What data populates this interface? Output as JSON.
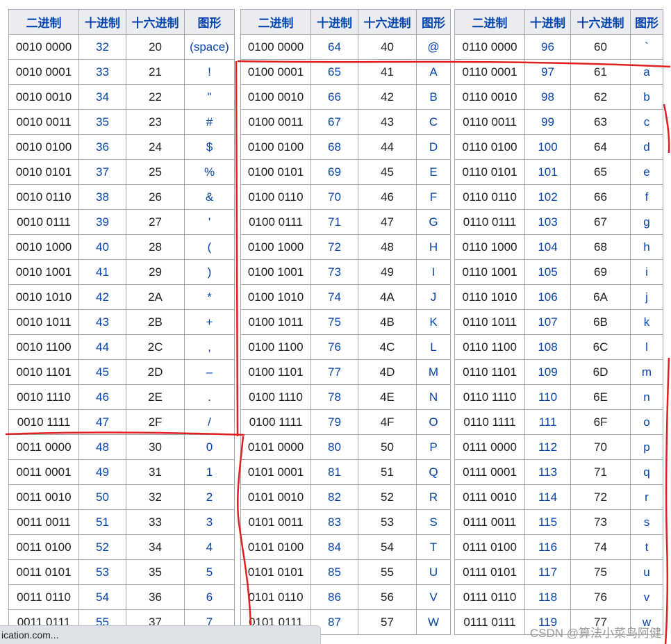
{
  "headers": [
    "二进制",
    "十进制",
    "十六进制",
    "图形"
  ],
  "tables": [
    {
      "rows": [
        [
          "0010 0000",
          "32",
          "20",
          "(space)"
        ],
        [
          "0010 0001",
          "33",
          "21",
          "!"
        ],
        [
          "0010 0010",
          "34",
          "22",
          "\""
        ],
        [
          "0010 0011",
          "35",
          "23",
          "#"
        ],
        [
          "0010 0100",
          "36",
          "24",
          "$"
        ],
        [
          "0010 0101",
          "37",
          "25",
          "%"
        ],
        [
          "0010 0110",
          "38",
          "26",
          "&"
        ],
        [
          "0010 0111",
          "39",
          "27",
          "'"
        ],
        [
          "0010 1000",
          "40",
          "28",
          "("
        ],
        [
          "0010 1001",
          "41",
          "29",
          ")"
        ],
        [
          "0010 1010",
          "42",
          "2A",
          "*"
        ],
        [
          "0010 1011",
          "43",
          "2B",
          "+"
        ],
        [
          "0010 1100",
          "44",
          "2C",
          ","
        ],
        [
          "0010 1101",
          "45",
          "2D",
          "–"
        ],
        [
          "0010 1110",
          "46",
          "2E",
          "."
        ],
        [
          "0010 1111",
          "47",
          "2F",
          "/"
        ],
        [
          "0011 0000",
          "48",
          "30",
          "0"
        ],
        [
          "0011 0001",
          "49",
          "31",
          "1"
        ],
        [
          "0011 0010",
          "50",
          "32",
          "2"
        ],
        [
          "0011 0011",
          "51",
          "33",
          "3"
        ],
        [
          "0011 0100",
          "52",
          "34",
          "4"
        ],
        [
          "0011 0101",
          "53",
          "35",
          "5"
        ],
        [
          "0011 0110",
          "54",
          "36",
          "6"
        ],
        [
          "0011 0111",
          "55",
          "37",
          "7"
        ]
      ]
    },
    {
      "rows": [
        [
          "0100 0000",
          "64",
          "40",
          "@"
        ],
        [
          "0100 0001",
          "65",
          "41",
          "A"
        ],
        [
          "0100 0010",
          "66",
          "42",
          "B"
        ],
        [
          "0100 0011",
          "67",
          "43",
          "C"
        ],
        [
          "0100 0100",
          "68",
          "44",
          "D"
        ],
        [
          "0100 0101",
          "69",
          "45",
          "E"
        ],
        [
          "0100 0110",
          "70",
          "46",
          "F"
        ],
        [
          "0100 0111",
          "71",
          "47",
          "G"
        ],
        [
          "0100 1000",
          "72",
          "48",
          "H"
        ],
        [
          "0100 1001",
          "73",
          "49",
          "I"
        ],
        [
          "0100 1010",
          "74",
          "4A",
          "J"
        ],
        [
          "0100 1011",
          "75",
          "4B",
          "K"
        ],
        [
          "0100 1100",
          "76",
          "4C",
          "L"
        ],
        [
          "0100 1101",
          "77",
          "4D",
          "M"
        ],
        [
          "0100 1110",
          "78",
          "4E",
          "N"
        ],
        [
          "0100 1111",
          "79",
          "4F",
          "O"
        ],
        [
          "0101 0000",
          "80",
          "50",
          "P"
        ],
        [
          "0101 0001",
          "81",
          "51",
          "Q"
        ],
        [
          "0101 0010",
          "82",
          "52",
          "R"
        ],
        [
          "0101 0011",
          "83",
          "53",
          "S"
        ],
        [
          "0101 0100",
          "84",
          "54",
          "T"
        ],
        [
          "0101 0101",
          "85",
          "55",
          "U"
        ],
        [
          "0101 0110",
          "86",
          "56",
          "V"
        ],
        [
          "0101 0111",
          "87",
          "57",
          "W"
        ]
      ]
    },
    {
      "rows": [
        [
          "0110 0000",
          "96",
          "60",
          "`"
        ],
        [
          "0110 0001",
          "97",
          "61",
          "a"
        ],
        [
          "0110 0010",
          "98",
          "62",
          "b"
        ],
        [
          "0110 0011",
          "99",
          "63",
          "c"
        ],
        [
          "0110 0100",
          "100",
          "64",
          "d"
        ],
        [
          "0110 0101",
          "101",
          "65",
          "e"
        ],
        [
          "0110 0110",
          "102",
          "66",
          "f"
        ],
        [
          "0110 0111",
          "103",
          "67",
          "g"
        ],
        [
          "0110 1000",
          "104",
          "68",
          "h"
        ],
        [
          "0110 1001",
          "105",
          "69",
          "i"
        ],
        [
          "0110 1010",
          "106",
          "6A",
          "j"
        ],
        [
          "0110 1011",
          "107",
          "6B",
          "k"
        ],
        [
          "0110 1100",
          "108",
          "6C",
          "l"
        ],
        [
          "0110 1101",
          "109",
          "6D",
          "m"
        ],
        [
          "0110 1110",
          "110",
          "6E",
          "n"
        ],
        [
          "0110 1111",
          "111",
          "6F",
          "o"
        ],
        [
          "0111 0000",
          "112",
          "70",
          "p"
        ],
        [
          "0111 0001",
          "113",
          "71",
          "q"
        ],
        [
          "0111 0010",
          "114",
          "72",
          "r"
        ],
        [
          "0111 0011",
          "115",
          "73",
          "s"
        ],
        [
          "0111 0100",
          "116",
          "74",
          "t"
        ],
        [
          "0111 0101",
          "117",
          "75",
          "u"
        ],
        [
          "0111 0110",
          "118",
          "76",
          "v"
        ],
        [
          "0111 0111",
          "119",
          "77",
          "w"
        ]
      ]
    }
  ],
  "status_bar": {
    "url": "ication.com..."
  },
  "watermark": "CSDN @算法小菜鸟阿健",
  "colors": {
    "link": "#0645ad",
    "header_bg": "#eaecf0",
    "border": "#a2a9b1",
    "annotation": "#e02020"
  }
}
